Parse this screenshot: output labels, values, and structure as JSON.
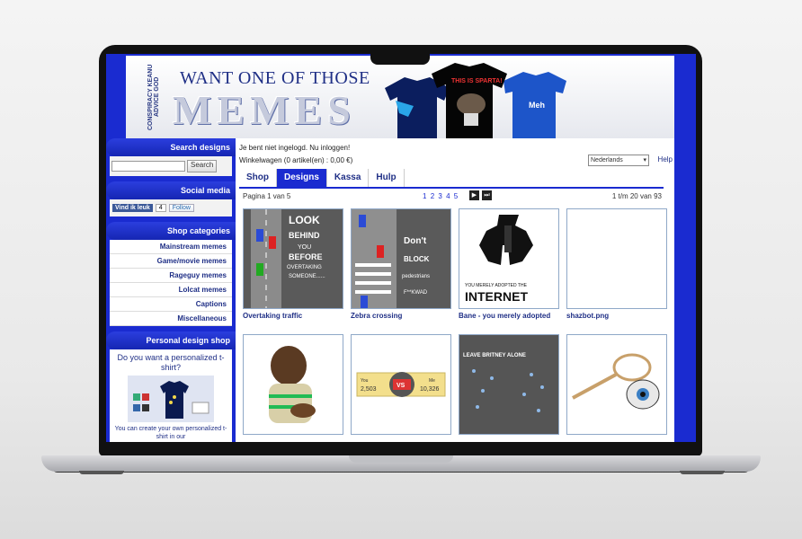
{
  "banner": {
    "side_text": "CONSPIRACY KEANU ADVICE GOD",
    "title_small": "WANT ONE OF THOSE",
    "title_big": "MEMES",
    "shirt_text_1": "THIS IS SPARTA!",
    "shirt_text_2": "Meh",
    "tagline": ""
  },
  "sidebar": {
    "search_title": "Search designs",
    "search_button": "Search",
    "social_title": "Social media",
    "facebook_label": "Vind ik leuk",
    "facebook_count": "4",
    "twitter_label": "Follow",
    "categories_title": "Shop categories",
    "categories": [
      "Mainstream memes",
      "Game/movie memes",
      "Rageguy memes",
      "Lolcat memes",
      "Captions",
      "Miscellaneous"
    ],
    "personal_title": "Personal design shop",
    "personal_question": "Do you want a personalized t-shirt?",
    "personal_text": "You can create your own personalized t-shirt in our"
  },
  "main": {
    "login_text": "Je bent niet ingelogd. Nu inloggen!",
    "cart_text": "Winkelwagen  (0 artikel(en) : 0,00 €)",
    "language": "Nederlands",
    "help": "Help",
    "tabs": [
      "Shop",
      "Designs",
      "Kassa",
      "Hulp"
    ],
    "active_tab": "Designs",
    "page_label": "Pagina 1 van 5",
    "pages": [
      "1",
      "2",
      "3",
      "4",
      "5"
    ],
    "results": "1 t/m 20 van 93"
  },
  "designs": [
    {
      "caption": "Overtaking traffic",
      "lines": [
        "LOOK",
        "BEHIND",
        "YOU",
        "BEFORE",
        "OVERTAKING",
        "SOMEONE......"
      ]
    },
    {
      "caption": "Zebra crossing",
      "lines": [
        "Don't",
        "BLOCK",
        "pedestrians",
        "F**KWAD"
      ]
    },
    {
      "caption": "Bane - you merely adopted",
      "lines": [
        "YOU MERELY ADOPTED THE",
        "INTERNET"
      ]
    },
    {
      "caption": "shazbot.png",
      "lines": []
    },
    {
      "caption": "",
      "lines": []
    },
    {
      "caption": "",
      "lines": [
        "You",
        "2,503",
        "VS",
        "Me",
        "10,326"
      ]
    },
    {
      "caption": "",
      "lines": [
        "LEAVE BRITNEY ALONE"
      ]
    },
    {
      "caption": "",
      "lines": []
    }
  ],
  "colors": {
    "brand_blue": "#1a2bd0",
    "link_blue": "#1f2f86"
  }
}
